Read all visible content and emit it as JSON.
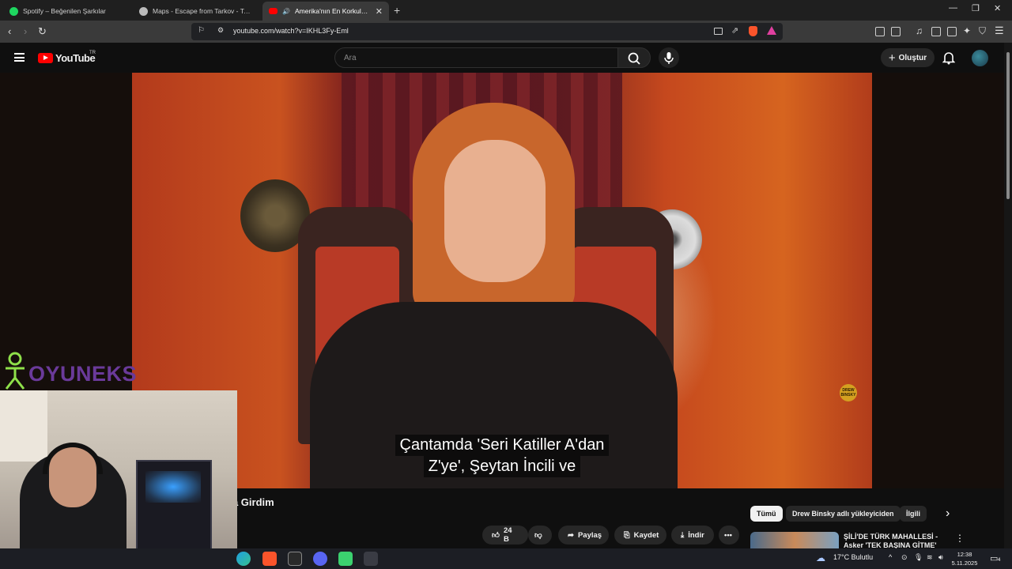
{
  "browser": {
    "tabs": [
      {
        "title": "Spotify – Beğenilen Şarkılar",
        "icon": "spotify-icon",
        "color": "#1ed760"
      },
      {
        "title": "Maps - Escape from Tarkov - Tarkov",
        "icon": "tarkov-icon",
        "color": "#bbbbbb"
      },
      {
        "title": "Amerika'nın En Korkulan Şeytan",
        "icon": "youtube-icon",
        "color": "#ff0000"
      }
    ],
    "url": "youtube.com/watch?v=IKHL3Fy-Eml"
  },
  "youtube": {
    "logo_text": "YouTube",
    "country": "TR",
    "search_placeholder": "Ara",
    "create_label": "Oluştur",
    "video": {
      "subtitle_line1": "Çantamda 'Seri Katiller A'dan",
      "subtitle_line2": "Z'ye', Şeytan İncili ve",
      "channel_bug": "DREW BINSKY",
      "title_visible": "na Girdim",
      "likes": "24 B",
      "share_label": "Paylaş",
      "save_label": "Kaydet",
      "download_label": "İndir"
    },
    "chips": [
      "Tümü",
      "Drew Binsky adlı yükleyiciden",
      "İlgili"
    ],
    "related": {
      "title": "ŞİLİ'DE TÜRK MAHALLESİ - Asker 'TEK BAŞINA GİTME'"
    }
  },
  "stream_overlay": {
    "brand": "OYUNEKS"
  },
  "taskbar": {
    "weather": "17°C  Bulutlu",
    "time": "12:38",
    "date": "5.11.2025",
    "notifications": "4"
  },
  "colors": {
    "youtube_red": "#ff0000",
    "brand_purple": "#6a3a9a",
    "brand_green": "#8ee04a"
  }
}
